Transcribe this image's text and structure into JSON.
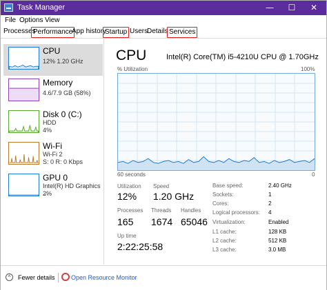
{
  "window": {
    "title": "Task Manager",
    "min": "—",
    "max": "☐",
    "close": "✕"
  },
  "menu": {
    "file": "File",
    "options": "Options",
    "view": "View"
  },
  "tabs": [
    "Processes",
    "Performance",
    "App history",
    "Startup",
    "Users",
    "Details",
    "Services"
  ],
  "sidebar": {
    "items": [
      {
        "name": "CPU",
        "sub1": "12%  1.20 GHz",
        "sub2": ""
      },
      {
        "name": "Memory",
        "sub1": "4.6/7.9 GB (58%)",
        "sub2": ""
      },
      {
        "name": "Disk 0 (C:)",
        "sub1": "HDD",
        "sub2": "4%"
      },
      {
        "name": "Wi-Fi",
        "sub1": "Wi-Fi 2",
        "sub2": "S: 0  R: 0 Kbps"
      },
      {
        "name": "GPU 0",
        "sub1": "Intel(R) HD Graphics ...",
        "sub2": "2%"
      }
    ]
  },
  "main": {
    "title": "CPU",
    "model": "Intel(R) Core(TM) i5-4210U CPU @ 1.70GHz",
    "util_label": "% Utilization",
    "util_max": "100%",
    "time_span": "60 seconds",
    "time_end": "0",
    "utilization_history": [
      8,
      9,
      7,
      10,
      8,
      9,
      12,
      8,
      7,
      9,
      10,
      8,
      9,
      7,
      11,
      8,
      9,
      14,
      9,
      8,
      10,
      8,
      12,
      9,
      8,
      10,
      9,
      13,
      8,
      9,
      7,
      10,
      8,
      9,
      11,
      8,
      9,
      10,
      8,
      12
    ],
    "stats": {
      "utilization": {
        "label": "Utilization",
        "value": "12%"
      },
      "speed": {
        "label": "Speed",
        "value": "1.20 GHz"
      },
      "processes": {
        "label": "Processes",
        "value": "165"
      },
      "threads": {
        "label": "Threads",
        "value": "1674"
      },
      "handles": {
        "label": "Handles",
        "value": "65046"
      },
      "uptime": {
        "label": "Up time",
        "value": "2:22:25:58"
      }
    },
    "details": [
      {
        "label": "Base speed:",
        "value": "2.40 GHz"
      },
      {
        "label": "Sockets:",
        "value": "1"
      },
      {
        "label": "Cores:",
        "value": "2"
      },
      {
        "label": "Logical processors:",
        "value": "4"
      },
      {
        "label": "Virtualization:",
        "value": "Enabled"
      },
      {
        "label": "L1 cache:",
        "value": "128 KB"
      },
      {
        "label": "L2 cache:",
        "value": "512 KB"
      },
      {
        "label": "L3 cache:",
        "value": "3.0 MB"
      }
    ]
  },
  "footer": {
    "fewer": "Fewer details",
    "monitor": "Open Resource Monitor",
    "fewer_icon": "^"
  },
  "colors": {
    "titlebar": "#5b2c9c",
    "highlight": "#e02020",
    "cpu": "#1e7bd0",
    "memory": "#8b3fb8",
    "disk": "#5aa82a",
    "wifi": "#b87a2a",
    "gpu": "#1e7bd0",
    "link": "#1f5fbf"
  }
}
